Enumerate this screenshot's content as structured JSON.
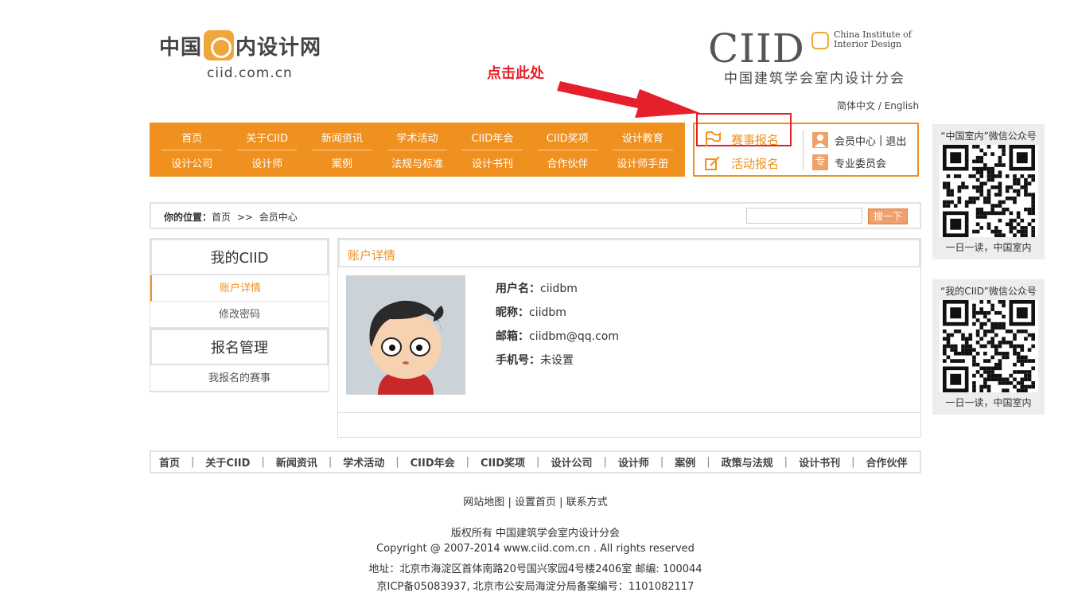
{
  "header": {
    "logo_left_cn_1": "中国",
    "logo_left_cn_2": "内设计网",
    "logo_left_domain": "ciid.com.cn",
    "logo_right_big": "CIID",
    "logo_right_en_1": "China Institute of",
    "logo_right_en_2": "Interior Design",
    "logo_right_cn": "中国建筑学会室内设计分会",
    "lang_cn": "简体中文",
    "lang_sep": "/",
    "lang_en": "English"
  },
  "annotation": {
    "text": "点击此处",
    "color": "#e5202a"
  },
  "nav": {
    "top": [
      "首页",
      "关于CIID",
      "新闻资讯",
      "学术活动",
      "CIID年会",
      "CIID奖项",
      "设计教育"
    ],
    "bottom": [
      "设计公司",
      "设计师",
      "案例",
      "法规与标准",
      "设计书刊",
      "合作伙伴",
      "设计师手册"
    ],
    "bg_color": "#f0901e"
  },
  "member_box": {
    "event_signup": "赛事报名",
    "activity_signup": "活动报名",
    "member_center": "会员中心",
    "sep": "|",
    "logout": "退出",
    "committee": "专业委员会",
    "committee_icon_char": "专"
  },
  "location": {
    "label": "你的位置：",
    "home": "首页",
    "sep": ">>",
    "current": "会员中心",
    "search_button": "搜一下"
  },
  "left_menu": {
    "section1_title": "我的CIID",
    "section1_items": [
      "账户详情",
      "修改密码"
    ],
    "section2_title": "报名管理",
    "section2_items": [
      "我报名的赛事"
    ]
  },
  "content": {
    "title": "账户详情",
    "username_label": "用户名：",
    "username": "ciidbm",
    "nickname_label": "昵称：",
    "nickname": "ciidbm",
    "email_label": "邮箱：",
    "email": "ciidbm@qq.com",
    "phone_label": "手机号：",
    "phone": "未设置"
  },
  "footer_nav": [
    "首页",
    "关于CIID",
    "新闻资讯",
    "学术活动",
    "CIID年会",
    "CIID奖项",
    "设计公司",
    "设计师",
    "案例",
    "政策与法规",
    "设计书刊",
    "合作伙伴"
  ],
  "footer": {
    "links_1": "网站地图",
    "links_2": "设置首页",
    "links_3": "联系方式",
    "link_sep": "|",
    "rights": "版权所有 中国建筑学会室内设计分会",
    "copyright": "Copyright @ 2007-2014 www.ciid.com.cn . All rights reserved",
    "address": "地址：北京市海淀区首体南路20号国兴家园4号楼2406室 邮编: 100044",
    "icp": "京ICP备05083937, 北京市公安局海淀分局备案编号：1101082117"
  },
  "side": {
    "qr1_title": "“中国室内”微信公众号",
    "qr1_caption": "一日一读，中国室内",
    "qr2_title": "“我的CIID”微信公众号",
    "qr2_caption": "一日一读，中国室内"
  }
}
